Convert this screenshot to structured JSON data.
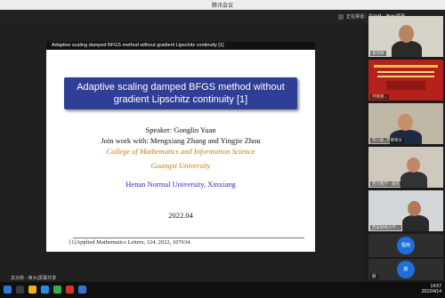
{
  "window": {
    "title": "腾讯会议"
  },
  "share_bar": {
    "text": "正在讲话：袁功林 - 西大(屏幕..."
  },
  "slide": {
    "header": "Adaptive scaling damped BFGS method without gradient Lipschitz continuity [1]",
    "title_line1": "Adaptive scaling damped BFGS method without",
    "title_line2": "gradient Lipschitz continuity [1]",
    "speaker": "Speaker: Gonglin Yuan",
    "joint": "Join work with: Mengxiang Zhang and Yingjie Zhou",
    "college": "College of Mathematics and Information Science",
    "university": "Guangxi University",
    "host": "Henan Normal University, Xinxiang",
    "date": "2022.04",
    "footnote": "[1]Applied Mathematics Letters, 124, 2022, 107634.",
    "colors": {
      "title_box": "#2f3e97",
      "college": "#c77a12",
      "host": "#2a2ac8"
    }
  },
  "participants": [
    {
      "label": "袁功林",
      "type": "video"
    },
    {
      "label": "河南师...",
      "type": "poster"
    },
    {
      "label": "苏小斯_河南师大",
      "type": "video"
    },
    {
      "label": "西大数学 - 胡夫",
      "type": "video"
    },
    {
      "label": "西安财经大学...",
      "type": "video"
    },
    {
      "label": "程雨",
      "type": "avatar",
      "avatar_text": "程雨"
    },
    {
      "label": "颜",
      "type": "avatar",
      "avatar_text": "颜"
    }
  ],
  "taskbar": {
    "share_label": "袁功林 - 西大(屏幕共享",
    "time": "14:57",
    "date": "2022/4/14"
  }
}
